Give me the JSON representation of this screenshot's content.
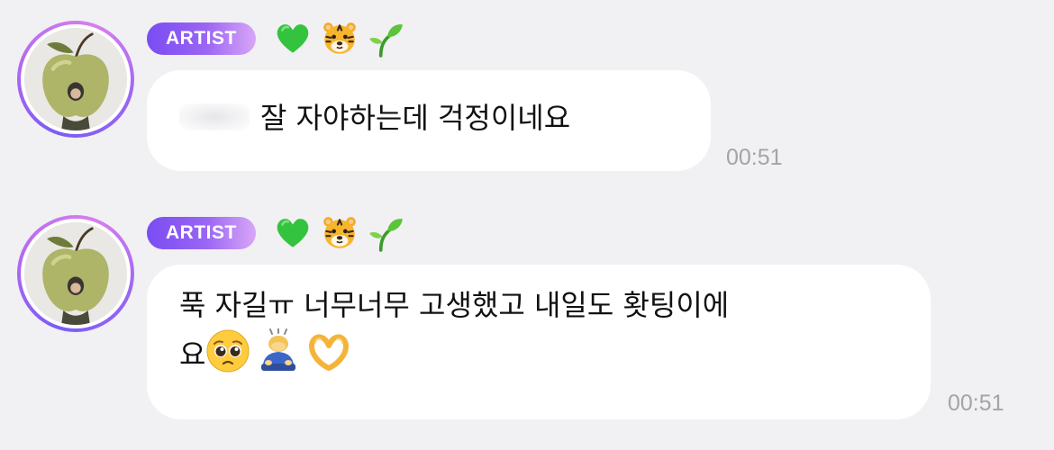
{
  "messages": [
    {
      "badge": "ARTIST",
      "emojis": [
        "green-heart-icon",
        "tiger-face-icon",
        "seedling-icon"
      ],
      "text": "잘 자야하는데 걱정이네요",
      "time": "00:51"
    },
    {
      "badge": "ARTIST",
      "emojis": [
        "green-heart-icon",
        "tiger-face-icon",
        "seedling-icon"
      ],
      "text_line1": "푹 자길ㅠ 너무너무 고생했고 내일도 홧팅이에",
      "text_line2": "요",
      "trailing_emojis": [
        "pleading-face-icon",
        "bowing-person-icon",
        "heart-hands-icon"
      ],
      "time": "00:51"
    }
  ],
  "colors": {
    "background": "#f1f1f3",
    "bubble": "#ffffff",
    "badge_start": "#7a4cf2",
    "badge_end": "#d8a6f7",
    "timestamp": "#a3a3a8"
  }
}
